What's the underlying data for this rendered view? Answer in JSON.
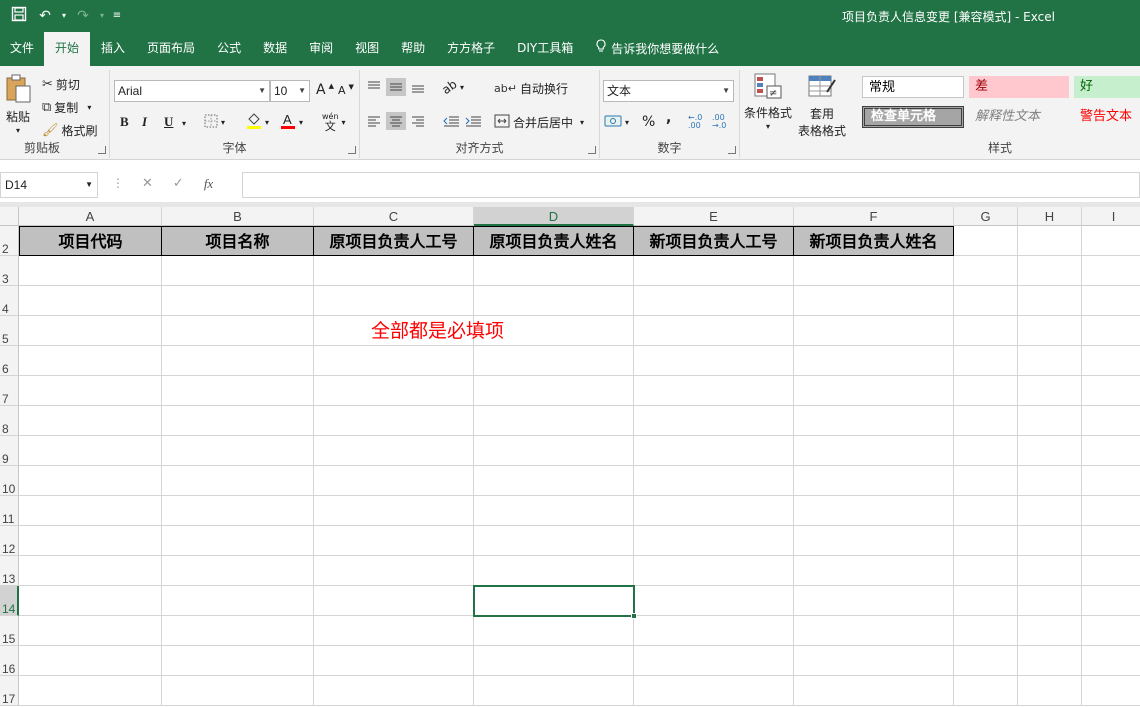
{
  "window": {
    "title": "项目负责人信息变更  [兼容模式]  -  Excel",
    "qat": {
      "save_icon": "save-icon",
      "undo_icon": "undo-icon",
      "redo_icon": "redo-icon",
      "customize_icon": "customize-icon"
    }
  },
  "tabs": [
    {
      "label": "文件",
      "active": false
    },
    {
      "label": "开始",
      "active": true
    },
    {
      "label": "插入",
      "active": false
    },
    {
      "label": "页面布局",
      "active": false
    },
    {
      "label": "公式",
      "active": false
    },
    {
      "label": "数据",
      "active": false
    },
    {
      "label": "审阅",
      "active": false
    },
    {
      "label": "视图",
      "active": false
    },
    {
      "label": "帮助",
      "active": false
    },
    {
      "label": "方方格子",
      "active": false
    },
    {
      "label": "DIY工具箱",
      "active": false
    }
  ],
  "tell_me": "告诉我你想要做什么",
  "ribbon": {
    "clipboard": {
      "paste": "粘贴",
      "cut": "剪切",
      "copy": "复制",
      "format_painter": "格式刷",
      "label": "剪贴板"
    },
    "font": {
      "name": "Arial",
      "size": "10",
      "bold": "B",
      "italic": "I",
      "underline": "U",
      "label": "字体",
      "grow": "A",
      "shrink": "A",
      "phonetic": "wén"
    },
    "alignment": {
      "wrap": "自动换行",
      "merge": "合并后居中",
      "label": "对齐方式"
    },
    "number": {
      "format": "文本",
      "percent": "%",
      "comma": ",",
      "label": "数字",
      "inc_decimal": "←.0 .00",
      "dec_decimal": ".00 →.0"
    },
    "styles": {
      "conditional": "条件格式",
      "table": [
        "套用",
        "表格格式"
      ],
      "normal": "常规",
      "bad": "差",
      "good": "好",
      "check": "检查单元格",
      "explanatory": "解释性文本",
      "warning": "警告文本",
      "label": "样式"
    }
  },
  "formula_bar": {
    "name_box": "D14",
    "cancel": "✕",
    "enter": "✓",
    "fx": "fx",
    "value": ""
  },
  "columns": [
    "A",
    "B",
    "C",
    "D",
    "E",
    "F",
    "G",
    "H",
    "I"
  ],
  "rows": [
    "2",
    "3",
    "4",
    "5",
    "6",
    "7",
    "8",
    "9",
    "10",
    "11",
    "12",
    "13",
    "14",
    "15",
    "16",
    "17"
  ],
  "header_row": [
    "项目代码",
    "项目名称",
    "原项目负责人工号",
    "原项目负责人姓名",
    "新项目负责人工号",
    "新项目负责人姓名"
  ],
  "note": "全部都是必填项",
  "selected": {
    "cell": "D14",
    "column": "D",
    "row": "14"
  },
  "colors": {
    "accent": "#217346",
    "header_fill": "#c0c0c0",
    "note": "#ff0000"
  }
}
